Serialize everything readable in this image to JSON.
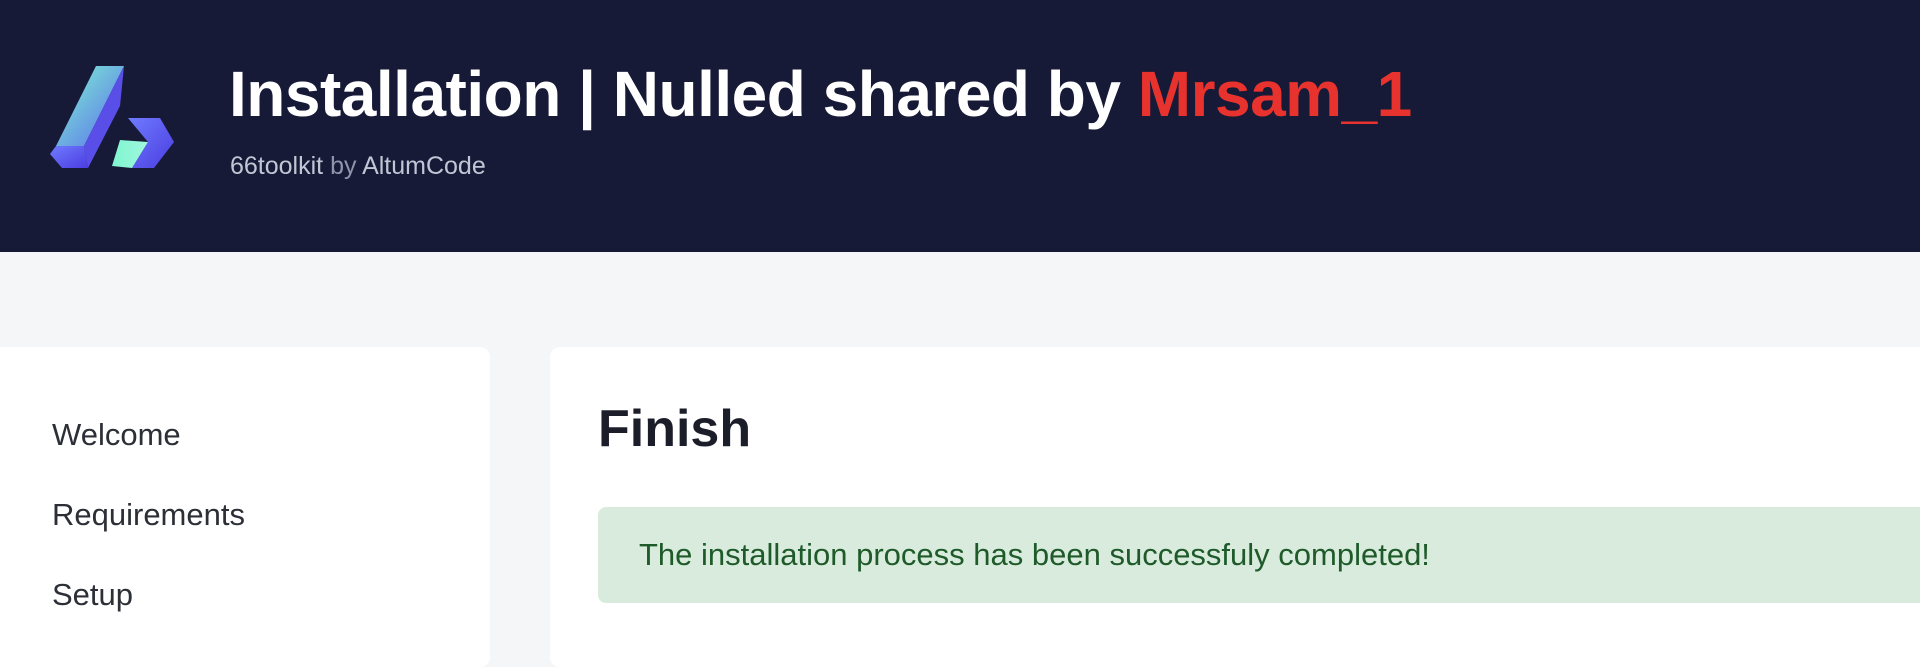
{
  "header": {
    "title_prefix": "Installation | Nulled shared by ",
    "title_accent": "Mrsam_1",
    "product": "66toolkit",
    "by": "by",
    "vendor": "AltumCode",
    "logo_icon": "altumcode-logo-icon",
    "colors": {
      "background": "#171a37",
      "accent": "#e8322d"
    }
  },
  "sidebar": {
    "items": [
      {
        "label": "Welcome"
      },
      {
        "label": "Requirements"
      },
      {
        "label": "Setup"
      }
    ]
  },
  "main": {
    "title": "Finish",
    "alert": {
      "message": "The installation process has been successfuly completed!",
      "color": "#d8ebdc"
    }
  }
}
